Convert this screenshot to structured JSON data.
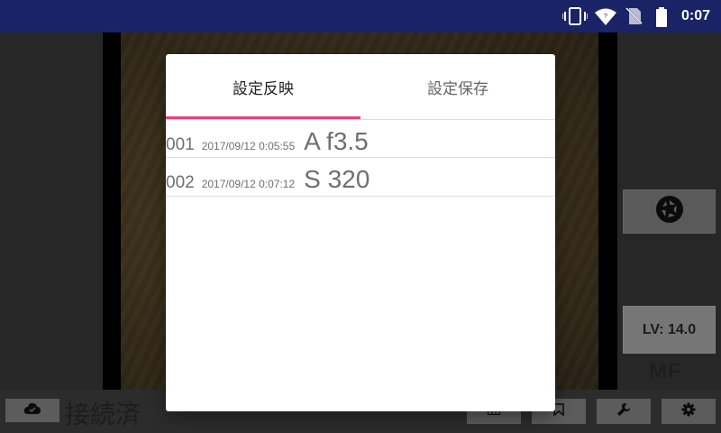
{
  "status_bar": {
    "time": "0:07",
    "icons": [
      "vibrate-icon",
      "wifi-icon",
      "no-sim-icon",
      "battery-icon"
    ]
  },
  "camera": {
    "lv_label": "LV: 14.0",
    "focus_mode": "MF",
    "connection_status": "接続済",
    "icons": [
      "shutter-icon",
      "cloud-icon",
      "grid-icon",
      "bookmark-icon",
      "wrench-icon",
      "gear-icon"
    ]
  },
  "dialog": {
    "tabs": [
      {
        "label": "設定反映",
        "active": true
      },
      {
        "label": "設定保存",
        "active": false
      }
    ],
    "rows": [
      {
        "num": "001",
        "date": "2017/09/12 0:05:55",
        "value": "A f3.5"
      },
      {
        "num": "002",
        "date": "2017/09/12 0:07:12",
        "value": "S 320"
      }
    ]
  },
  "colors": {
    "status_bar_bg": "#1a2366",
    "tab_indicator": "#e8417f"
  }
}
